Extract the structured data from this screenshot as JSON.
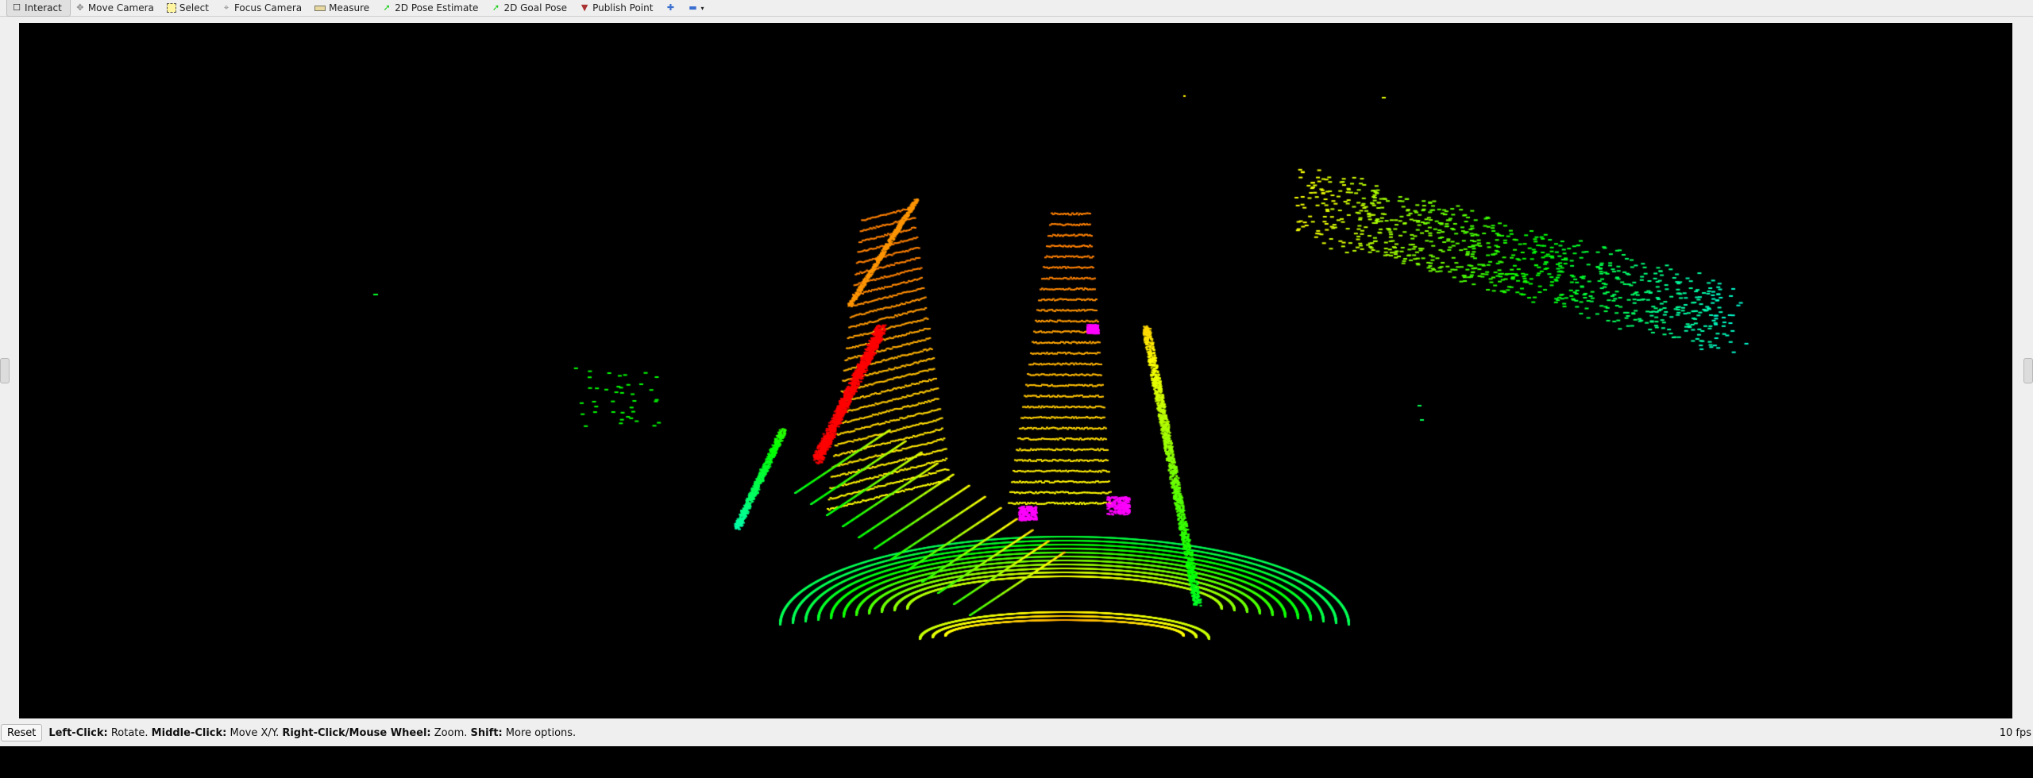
{
  "toolbar": {
    "tools": [
      {
        "label": "Interact",
        "icon": "cursor-icon",
        "active": true
      },
      {
        "label": "Move Camera",
        "icon": "move-icon"
      },
      {
        "label": "Select",
        "icon": "select-icon"
      },
      {
        "label": "Focus Camera",
        "icon": "focus-icon"
      },
      {
        "label": "Measure",
        "icon": "ruler-icon"
      },
      {
        "label": "2D Pose Estimate",
        "icon": "green-arrow-icon"
      },
      {
        "label": "2D Goal Pose",
        "icon": "green-arrow-icon"
      },
      {
        "label": "Publish Point",
        "icon": "pin-icon"
      }
    ]
  },
  "status": {
    "reset_label": "Reset",
    "hint": [
      {
        "bold": "Left-Click:",
        "text": " Rotate. "
      },
      {
        "bold": "Middle-Click:",
        "text": " Move X/Y. "
      },
      {
        "bold": "Right-Click/Mouse Wheel:",
        "text": " Zoom. "
      },
      {
        "bold": "Shift:",
        "text": " More options."
      }
    ],
    "fps": "10 fps"
  },
  "colors": {
    "background": "#000000",
    "panel": "#efefef",
    "red": "#ff0000",
    "magenta": "#ff00ff"
  }
}
